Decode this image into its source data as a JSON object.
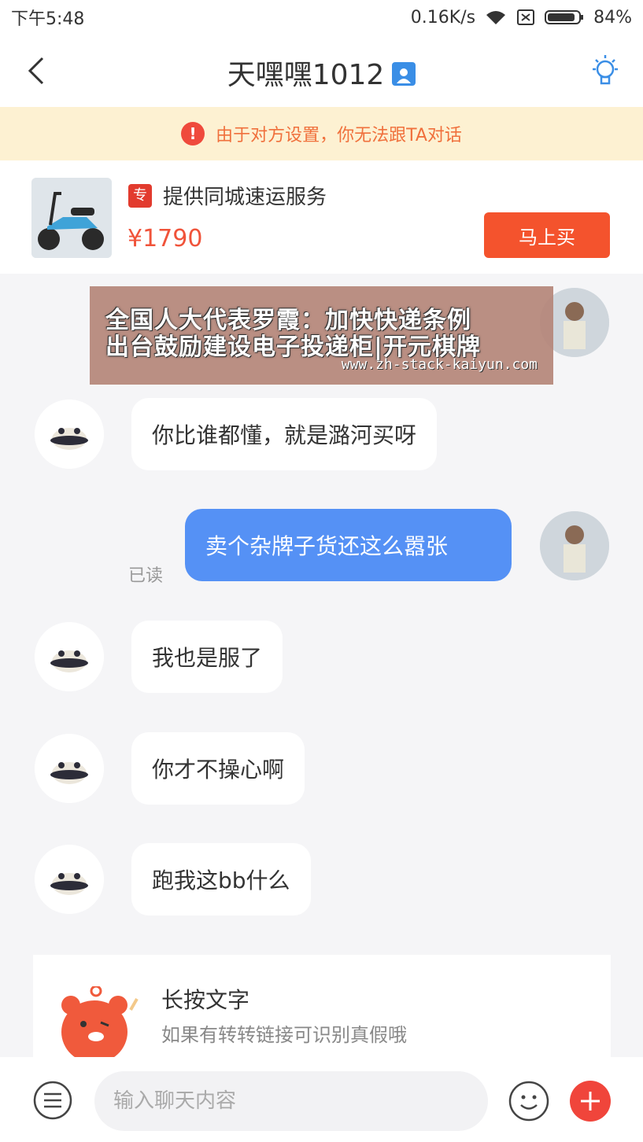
{
  "status_bar": {
    "time": "下午5:48",
    "network_speed": "0.16K/s",
    "battery": "84%"
  },
  "nav": {
    "title": "天嘿嘿1012",
    "back_icon": "chevron-left-icon",
    "verify_icon": "user-badge-icon",
    "bulb_icon": "lightbulb-icon"
  },
  "notice": {
    "text": "由于对方设置，你无法跟TA对话"
  },
  "product": {
    "badge": "专",
    "title": "提供同城速运服务",
    "price": "¥1790",
    "buy_label": "马上买"
  },
  "overlay": {
    "line1": "全国人大代表罗霞：加快快递条例",
    "line2": "出台鼓励建设电子投递柜|开元棋牌",
    "url": "www.zh-stack-kaiyun.com"
  },
  "messages": [
    {
      "side": "in",
      "text": "你比谁都懂，就是潞河买呀"
    },
    {
      "side": "out",
      "text": "卖个杂牌子货还这么嚣张",
      "status": "已读"
    },
    {
      "side": "in",
      "text": "我也是服了"
    },
    {
      "side": "in",
      "text": "你才不操心啊"
    },
    {
      "side": "in",
      "text": "跑我这bb什么"
    }
  ],
  "tip": {
    "title": "长按文字",
    "subtitle": "如果有转转链接可识别真假哦"
  },
  "input_bar": {
    "placeholder": "输入聊天内容"
  },
  "colors": {
    "accent": "#f4532d",
    "bubble_out": "#5591f5",
    "notice_bg": "#fdf1d2",
    "notice_text": "#f0703c"
  }
}
